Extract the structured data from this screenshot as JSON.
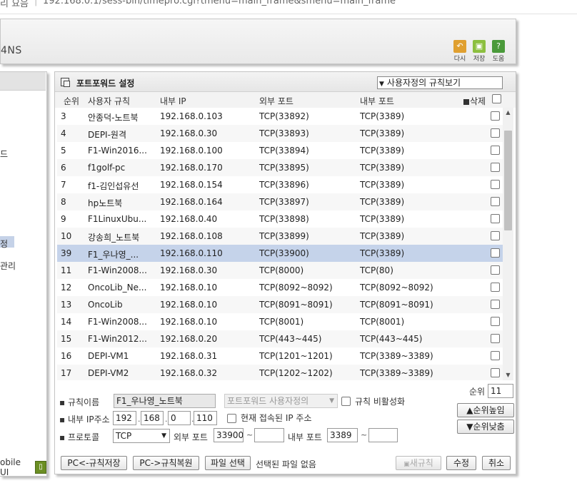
{
  "browser": {
    "tab_fragment": "리 요음",
    "url": "192.168.0.1/sess-bin/timepro.cgi?tmenu=main_frame&smenu=main_frame"
  },
  "header": {
    "brand": "4NS",
    "tools": [
      {
        "label": "다시",
        "icon": "undo-icon",
        "color": "#e0a030"
      },
      {
        "label": "저장",
        "icon": "save-icon",
        "color": "#8cbf3f"
      },
      {
        "label": "도움",
        "icon": "help-icon",
        "color": "#4a9a3a"
      }
    ]
  },
  "left_menu": {
    "fragments": [
      "드",
      "정",
      "관리"
    ],
    "mobile_label": "obile UI"
  },
  "panel": {
    "title": "포트포워드 설정",
    "view_select": "사용자정의 규칙보기"
  },
  "table": {
    "headers": {
      "rank": "순위",
      "rule": "사용자 규칙",
      "internal_ip": "내부 IP",
      "external_port": "외부 포트",
      "internal_port": "내부 포트",
      "delete": "삭제"
    },
    "rows": [
      {
        "rank": "3",
        "rule": "안종덕-노트북",
        "ip": "192.168.0.103",
        "ext": "TCP(33892)",
        "int": "TCP(3389)"
      },
      {
        "rank": "4",
        "rule": "DEPI-원격",
        "ip": "192.168.0.30",
        "ext": "TCP(33893)",
        "int": "TCP(3389)"
      },
      {
        "rank": "5",
        "rule": "F1-Win2016...",
        "ip": "192.168.0.100",
        "ext": "TCP(33894)",
        "int": "TCP(3389)"
      },
      {
        "rank": "6",
        "rule": "f1golf-pc",
        "ip": "192.168.0.170",
        "ext": "TCP(33895)",
        "int": "TCP(3389)"
      },
      {
        "rank": "7",
        "rule": "f1-김인섭유선",
        "ip": "192.168.0.154",
        "ext": "TCP(33896)",
        "int": "TCP(3389)"
      },
      {
        "rank": "8",
        "rule": "hp노트북",
        "ip": "192.168.0.164",
        "ext": "TCP(33897)",
        "int": "TCP(3389)"
      },
      {
        "rank": "9",
        "rule": "F1LinuxUbu...",
        "ip": "192.168.0.40",
        "ext": "TCP(33898)",
        "int": "TCP(3389)"
      },
      {
        "rank": "10",
        "rule": "강송희_노트북",
        "ip": "192.168.0.108",
        "ext": "TCP(33899)",
        "int": "TCP(3389)"
      },
      {
        "rank": "39",
        "rule": "F1_우나영_...",
        "ip": "192.168.0.110",
        "ext": "TCP(33900)",
        "int": "TCP(3389)",
        "selected": true
      },
      {
        "rank": "11",
        "rule": "F1-Win2008...",
        "ip": "192.168.0.30",
        "ext": "TCP(8000)",
        "int": "TCP(80)"
      },
      {
        "rank": "12",
        "rule": "OncoLib_Ne...",
        "ip": "192.168.0.10",
        "ext": "TCP(8092~8092)",
        "int": "TCP(8092~8092)"
      },
      {
        "rank": "13",
        "rule": "OncoLib",
        "ip": "192.168.0.10",
        "ext": "TCP(8091~8091)",
        "int": "TCP(8091~8091)"
      },
      {
        "rank": "14",
        "rule": "F1-Win2008...",
        "ip": "192.168.0.10",
        "ext": "TCP(8001)",
        "int": "TCP(8001)"
      },
      {
        "rank": "15",
        "rule": "F1-Win2012...",
        "ip": "192.168.0.20",
        "ext": "TCP(443~445)",
        "int": "TCP(443~445)"
      },
      {
        "rank": "16",
        "rule": "DEPI-VM1",
        "ip": "192.168.0.31",
        "ext": "TCP(1201~1201)",
        "int": "TCP(3389~3389)"
      },
      {
        "rank": "17",
        "rule": "DEPI-VM2",
        "ip": "192.168.0.32",
        "ext": "TCP(1202~1202)",
        "int": "TCP(3389~3389)"
      }
    ]
  },
  "form": {
    "rule_name_label": "규칙이름",
    "rule_name_value": "F1_우나영_노트북",
    "rule_type_value": "포트포워드 사용자정의",
    "disable_label": "규칙 비활성화",
    "rank_label": "순위",
    "rank_value": "11",
    "ip_label": "내부 IP주소",
    "ip_octets": [
      "192",
      "168",
      "0",
      "110"
    ],
    "current_ip_label": "현재 접속된 IP 주소",
    "protocol_label": "프로토콜",
    "protocol_value": "TCP",
    "ext_port_label": "외부 포트",
    "ext_port_from": "33900",
    "ext_port_to": "",
    "int_port_label": "내부 포트",
    "int_port_from": "3389",
    "int_port_to": "",
    "rank_up": "순위높임",
    "rank_down": "순위낮춤",
    "file_status": "선택된 파일 없음"
  },
  "buttons": {
    "save_to_pc": "PC<-규칙저장",
    "restore_from_pc": "PC->규칙복원",
    "choose_file": "파일 선택",
    "new_rule": "새규칙",
    "modify": "수정",
    "cancel": "취소"
  }
}
